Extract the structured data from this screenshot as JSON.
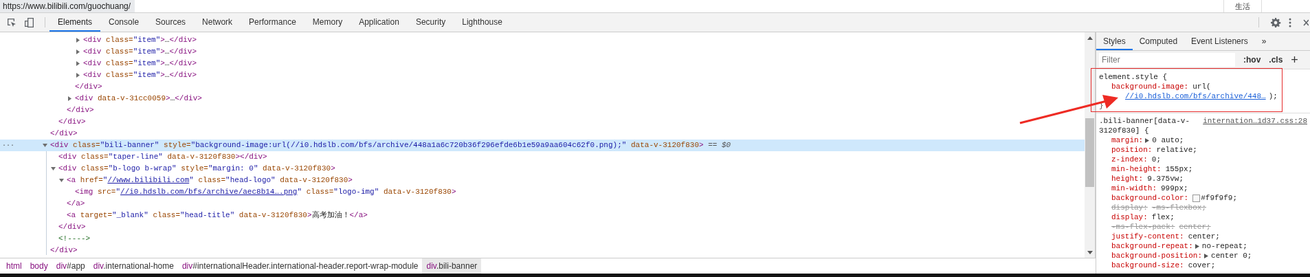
{
  "url_bar": {
    "url": "https://www.bilibili.com/guochuang/",
    "tab_label": "生活"
  },
  "toolbar": {
    "tabs": [
      {
        "label": "Elements",
        "selected": true
      },
      {
        "label": "Console",
        "selected": false
      },
      {
        "label": "Sources",
        "selected": false
      },
      {
        "label": "Network",
        "selected": false
      },
      {
        "label": "Performance",
        "selected": false
      },
      {
        "label": "Memory",
        "selected": false
      },
      {
        "label": "Application",
        "selected": false
      },
      {
        "label": "Security",
        "selected": false
      },
      {
        "label": "Lighthouse",
        "selected": false
      }
    ]
  },
  "dom_tree": [
    {
      "close": "</div>",
      "children": [
        {
          "close": "</div>",
          "children": [
            {
              "close": "</div>",
              "children": [
                {
                  "close": "</div>",
                  "children": [
                    {
                      "expanded": false,
                      "selected": false,
                      "tokens": [
                        {
                          "kind": "tag",
                          "t": "<div"
                        },
                        {
                          "kind": "name",
                          "t": " class="
                        },
                        {
                          "kind": "val",
                          "t": "\"item\""
                        },
                        {
                          "kind": "tag",
                          "t": ">"
                        },
                        {
                          "kind": "dim",
                          "t": "…"
                        },
                        {
                          "kind": "tag",
                          "t": "</div>"
                        }
                      ]
                    },
                    {
                      "expanded": false,
                      "selected": false,
                      "tokens": [
                        {
                          "kind": "tag",
                          "t": "<div"
                        },
                        {
                          "kind": "name",
                          "t": " class="
                        },
                        {
                          "kind": "val",
                          "t": "\"item\""
                        },
                        {
                          "kind": "tag",
                          "t": ">"
                        },
                        {
                          "kind": "dim",
                          "t": "…"
                        },
                        {
                          "kind": "tag",
                          "t": "</div>"
                        }
                      ]
                    },
                    {
                      "expanded": false,
                      "selected": false,
                      "tokens": [
                        {
                          "kind": "tag",
                          "t": "<div"
                        },
                        {
                          "kind": "name",
                          "t": " class="
                        },
                        {
                          "kind": "val",
                          "t": "\"item\""
                        },
                        {
                          "kind": "tag",
                          "t": ">"
                        },
                        {
                          "kind": "dim",
                          "t": "…"
                        },
                        {
                          "kind": "tag",
                          "t": "</div>"
                        }
                      ]
                    },
                    {
                      "expanded": false,
                      "selected": false,
                      "tokens": [
                        {
                          "kind": "tag",
                          "t": "<div"
                        },
                        {
                          "kind": "name",
                          "t": " class="
                        },
                        {
                          "kind": "val",
                          "t": "\"item\""
                        },
                        {
                          "kind": "tag",
                          "t": ">"
                        },
                        {
                          "kind": "dim",
                          "t": "…"
                        },
                        {
                          "kind": "tag",
                          "t": "</div>"
                        }
                      ]
                    }
                  ]
                },
                {
                  "expanded": false,
                  "selected": false,
                  "tokens": [
                    {
                      "kind": "tag",
                      "t": "<div"
                    },
                    {
                      "kind": "name",
                      "t": " data-v-31cc0059"
                    },
                    {
                      "kind": "tag",
                      "t": ">"
                    },
                    {
                      "kind": "dim",
                      "t": "…"
                    },
                    {
                      "kind": "tag",
                      "t": "</div>"
                    }
                  ]
                }
              ]
            }
          ]
        }
      ]
    },
    {
      "expanded": true,
      "selected": true,
      "gutter": "···",
      "close": "</div>",
      "tokens": [
        {
          "kind": "tag",
          "t": "<div"
        },
        {
          "kind": "name",
          "t": " class="
        },
        {
          "kind": "val",
          "t": "\"bili-banner\""
        },
        {
          "kind": "name",
          "t": " style="
        },
        {
          "kind": "val",
          "t": "\"background-image:url(//i0.hdslb.com/bfs/archive/448a1a6c720b36f296efde6b1e59a9aa604c62f0.png);\""
        },
        {
          "kind": "name",
          "t": " data-v-3120f830"
        },
        {
          "kind": "tag",
          "t": ">"
        },
        {
          "kind": "eq",
          "t": " == $0"
        }
      ],
      "children": [
        {
          "selected": false,
          "tokens": [
            {
              "kind": "tag",
              "t": "<div"
            },
            {
              "kind": "name",
              "t": " class="
            },
            {
              "kind": "val",
              "t": "\"taper-line\""
            },
            {
              "kind": "name",
              "t": " data-v-3120f830"
            },
            {
              "kind": "tag",
              "t": "></div>"
            }
          ]
        },
        {
          "expanded": true,
          "selected": false,
          "close": "</div>",
          "tokens": [
            {
              "kind": "tag",
              "t": "<div"
            },
            {
              "kind": "name",
              "t": " class="
            },
            {
              "kind": "val",
              "t": "\"b-logo b-wrap\""
            },
            {
              "kind": "name",
              "t": " style="
            },
            {
              "kind": "val",
              "t": "\"margin: 0\""
            },
            {
              "kind": "name",
              "t": " data-v-3120f830"
            },
            {
              "kind": "tag",
              "t": ">"
            }
          ],
          "children": [
            {
              "expanded": true,
              "selected": false,
              "close": "</a>",
              "tokens": [
                {
                  "kind": "tag",
                  "t": "<a"
                },
                {
                  "kind": "name",
                  "t": " href="
                },
                {
                  "kind": "val",
                  "t": "\""
                },
                {
                  "kind": "link",
                  "t": "//www.bilibili.com"
                },
                {
                  "kind": "val",
                  "t": "\""
                },
                {
                  "kind": "name",
                  "t": " class="
                },
                {
                  "kind": "val",
                  "t": "\"head-logo\""
                },
                {
                  "kind": "name",
                  "t": " data-v-3120f830"
                },
                {
                  "kind": "tag",
                  "t": ">"
                }
              ],
              "children": [
                {
                  "selected": false,
                  "tokens": [
                    {
                      "kind": "tag",
                      "t": "<img"
                    },
                    {
                      "kind": "name",
                      "t": " src="
                    },
                    {
                      "kind": "val",
                      "t": "\""
                    },
                    {
                      "kind": "link",
                      "t": "//i0.hdslb.com/bfs/archive/aec8b14….png"
                    },
                    {
                      "kind": "val",
                      "t": "\""
                    },
                    {
                      "kind": "name",
                      "t": " class="
                    },
                    {
                      "kind": "val",
                      "t": "\"logo-img\""
                    },
                    {
                      "kind": "name",
                      "t": " data-v-3120f830"
                    },
                    {
                      "kind": "tag",
                      "t": ">"
                    }
                  ]
                }
              ]
            },
            {
              "selected": false,
              "tokens": [
                {
                  "kind": "tag",
                  "t": "<a"
                },
                {
                  "kind": "name",
                  "t": " target="
                },
                {
                  "kind": "val",
                  "t": "\"_blank\""
                },
                {
                  "kind": "name",
                  "t": " class="
                },
                {
                  "kind": "val",
                  "t": "\"head-title\""
                },
                {
                  "kind": "name",
                  "t": " data-v-3120f830"
                },
                {
                  "kind": "tag",
                  "t": ">"
                },
                {
                  "kind": "text",
                  "t": "高考加油！"
                },
                {
                  "kind": "tag",
                  "t": "</a>"
                }
              ]
            }
          ]
        },
        {
          "selected": false,
          "tokens": [
            {
              "kind": "comment",
              "t": "<!---->"
            }
          ]
        }
      ]
    }
  ],
  "breadcrumbs": [
    {
      "tag": "html",
      "selected": false
    },
    {
      "tag": "body",
      "selected": false
    },
    {
      "tag": "div",
      "rest": "#app",
      "selected": false
    },
    {
      "tag": "div",
      "rest": ".international-home",
      "selected": false
    },
    {
      "tag": "div",
      "rest": "#internationalHeader.international-header.report-wrap-module",
      "selected": false
    },
    {
      "tag": "div",
      "rest": ".bili-banner",
      "selected": true
    }
  ],
  "styles_panel": {
    "tabs": [
      {
        "label": "Styles",
        "selected": true
      },
      {
        "label": "Computed",
        "selected": false
      },
      {
        "label": "Event Listeners",
        "selected": false
      }
    ],
    "more_tabs": "»",
    "filter": {
      "placeholder": "Filter"
    },
    "buttons": [
      ":hov",
      ".cls"
    ],
    "add_button": "+",
    "rules": [
      {
        "selector": "element.style {",
        "close": "}",
        "properties": [
          {
            "name": "background-image:",
            "value": "url(",
            "link": "//i0.hdslb.com/bfs/archive/448…",
            "tail": ");"
          }
        ]
      },
      {
        "selector": ".bili-banner[data-v-3120f830] {",
        "source": "internation…1d37.css:28",
        "properties": [
          {
            "name": "margin:",
            "value": "0 auto;",
            "expandable": true,
            "overridden": false
          },
          {
            "name": "position:",
            "value": "relative;",
            "overridden": false
          },
          {
            "name": "z-index:",
            "value": "0;",
            "overridden": false
          },
          {
            "name": "min-height:",
            "value": "155px;",
            "overridden": false
          },
          {
            "name": "height:",
            "value": "9.375vw;",
            "overridden": false
          },
          {
            "name": "min-width:",
            "value": "999px;",
            "overridden": false
          },
          {
            "name": "background-color:",
            "value": "#f9f9f9;",
            "color": "#f9f9f9",
            "overridden": false
          },
          {
            "name": "display:",
            "value": "-ms-flexbox;",
            "overridden": true
          },
          {
            "name": "display:",
            "value": "flex;",
            "overridden": false
          },
          {
            "name": "-ms-flex-pack:",
            "value": "center;",
            "overridden": true
          },
          {
            "name": "justify-content:",
            "value": "center;",
            "overridden": false
          },
          {
            "name": "background-repeat:",
            "value": "no-repeat;",
            "expandable": true,
            "overridden": false
          },
          {
            "name": "background-position:",
            "value": "center 0;",
            "expandable": true,
            "overridden": false
          },
          {
            "name": "background-size:",
            "value": "cover;",
            "overridden": false
          }
        ]
      }
    ]
  },
  "annotations": [
    {
      "kind": "box"
    },
    {
      "kind": "arrow"
    }
  ]
}
